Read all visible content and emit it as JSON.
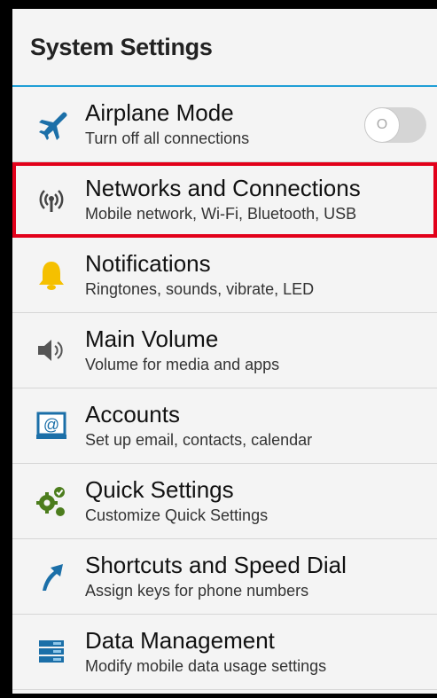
{
  "header": {
    "title": "System Settings"
  },
  "items": [
    {
      "title": "Airplane Mode",
      "subtitle": "Turn off all connections",
      "icon": "airplane-icon",
      "toggle": {
        "on": false,
        "knob_label": "O"
      }
    },
    {
      "title": "Networks and Connections",
      "subtitle": "Mobile network, Wi-Fi, Bluetooth, USB",
      "icon": "antenna-icon",
      "selected": true
    },
    {
      "title": "Notifications",
      "subtitle": "Ringtones, sounds, vibrate, LED",
      "icon": "bell-icon"
    },
    {
      "title": "Main Volume",
      "subtitle": "Volume for media and apps",
      "icon": "speaker-icon"
    },
    {
      "title": "Accounts",
      "subtitle": "Set up email, contacts, calendar",
      "icon": "at-sign-icon"
    },
    {
      "title": "Quick Settings",
      "subtitle": "Customize Quick Settings",
      "icon": "gear-check-icon"
    },
    {
      "title": "Shortcuts and Speed Dial",
      "subtitle": "Assign keys for phone numbers",
      "icon": "arrow-icon"
    },
    {
      "title": "Data Management",
      "subtitle": "Modify mobile data usage settings",
      "icon": "database-icon"
    }
  ],
  "colors": {
    "accent": "#1f9fd6",
    "selection": "#e2001a",
    "icon_blue": "#1b6fa8",
    "bell_yellow": "#f5c000",
    "gear_green": "#4c7d1d"
  }
}
